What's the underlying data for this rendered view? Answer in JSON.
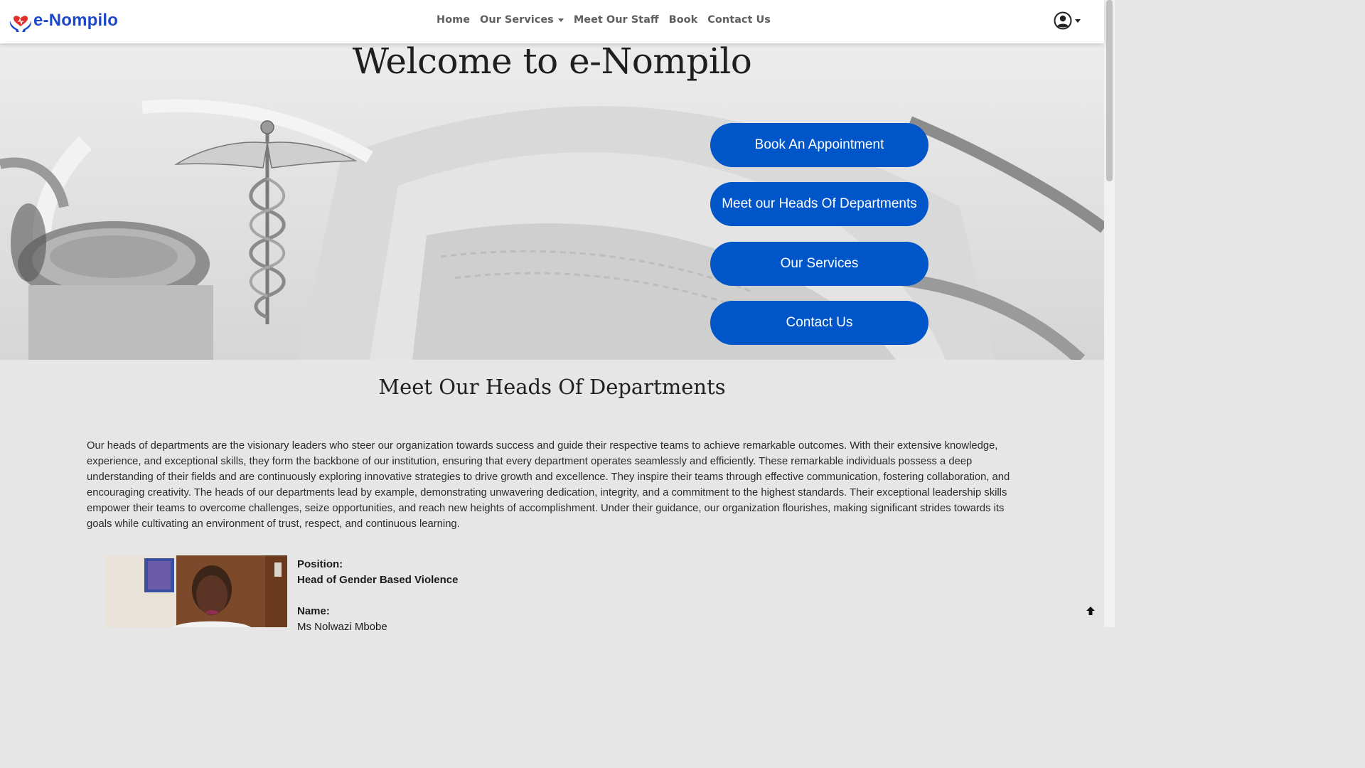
{
  "brand": {
    "name": "e-Nompilo",
    "logo_icon": "heart-hands-icon",
    "color": "#1d48c9"
  },
  "nav": {
    "home": "Home",
    "services": "Our Services",
    "staff": "Meet Our Staff",
    "book": "Book",
    "contact": "Contact Us",
    "user_icon": "user-circle-icon"
  },
  "hero": {
    "title": "Welcome to e-Nompilo",
    "buttons": {
      "book": "Book An Appointment",
      "heads": "Meet our Heads Of Departments",
      "services": "Our Services",
      "contact": "Contact Us"
    },
    "button_color": "#0055c8"
  },
  "heads_section": {
    "title": "Meet Our Heads Of Departments",
    "intro": "Our heads of departments are the visionary leaders who steer our organization towards success and guide their respective teams to achieve remarkable outcomes. With their extensive knowledge, experience, and exceptional skills, they form the backbone of our institution, ensuring that every department operates seamlessly and efficiently. These remarkable individuals possess a deep understanding of their fields and are continuously exploring innovative strategies to drive growth and excellence. They inspire their teams through effective communication, fostering collaboration, and encouraging creativity. The heads of our departments lead by example, demonstrating unwavering dedication, integrity, and a commitment to the highest standards. Their exceptional leadership skills empower their teams to overcome challenges, seize opportunities, and reach new heights of accomplishment. Under their guidance, our organization flourishes, making significant strides towards its goals while cultivating an environment of trust, respect, and continuous learning.",
    "heads": [
      {
        "position_label": "Position:",
        "position": "Head of Gender Based Violence",
        "name_label": "Name:",
        "name": "Ms Nolwazi Mbobe"
      }
    ]
  },
  "scroll_top_icon": "arrow-up-icon"
}
